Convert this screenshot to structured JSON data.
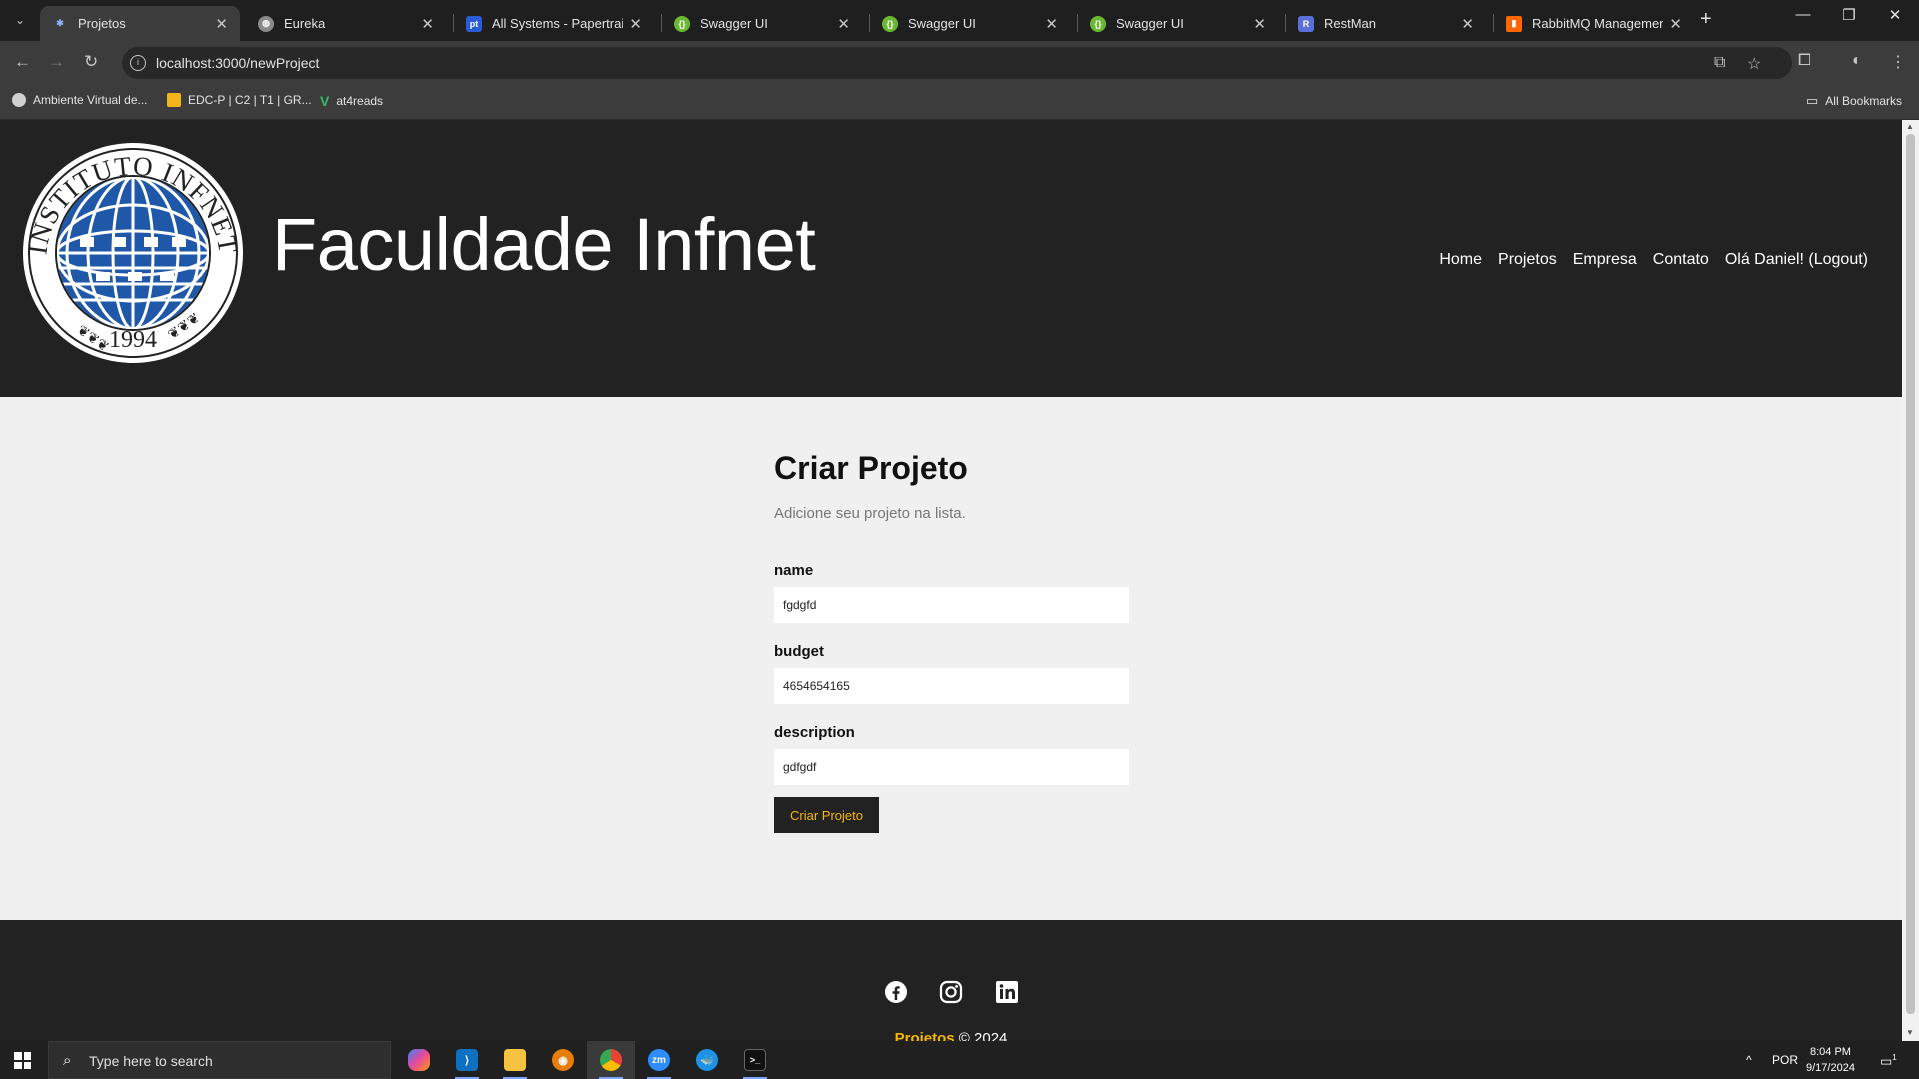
{
  "browser": {
    "tabs": [
      {
        "label": "Projetos",
        "active": true,
        "favicon_color": "#6b8fd6",
        "favicon_glyph": "✱"
      },
      {
        "label": "Eureka",
        "active": false,
        "favicon_color": "#8a8a8a",
        "favicon_glyph": "◍"
      },
      {
        "label": "All Systems - Papertrail",
        "active": false,
        "favicon_color": "#2a5bd7",
        "favicon_glyph": "pt"
      },
      {
        "label": "Swagger UI",
        "active": false,
        "favicon_color": "#6cb833",
        "favicon_glyph": "{}"
      },
      {
        "label": "Swagger UI",
        "active": false,
        "favicon_color": "#6cb833",
        "favicon_glyph": "{}"
      },
      {
        "label": "Swagger UI",
        "active": false,
        "favicon_color": "#6cb833",
        "favicon_glyph": "{}"
      },
      {
        "label": "RestMan",
        "active": false,
        "favicon_color": "#5a6fd8",
        "favicon_glyph": "R"
      },
      {
        "label": "RabbitMQ Management",
        "active": false,
        "favicon_color": "#ff6600",
        "favicon_glyph": "▮"
      }
    ],
    "url": "localhost:3000/newProject",
    "bookmarks": [
      {
        "label": "Ambiente Virtual de...",
        "icon_color": "#d0d0d0"
      },
      {
        "label": "EDC-P | C2 | T1 | GR...",
        "icon_color": "#f2b61c"
      },
      {
        "label": "at4reads",
        "icon_color": "#39b86b"
      }
    ],
    "all_bookmarks_label": "All Bookmarks"
  },
  "site": {
    "logo_text_top": "INSTITUTO INFNET",
    "logo_year": "1994",
    "title": "Faculdade Infnet",
    "nav": [
      "Home",
      "Projetos",
      "Empresa",
      "Contato",
      "Olá Daniel! (Logout)"
    ]
  },
  "form": {
    "title": "Criar Projeto",
    "subtitle": "Adicione seu projeto na lista.",
    "fields": [
      {
        "label": "name",
        "value": "fgdgfd"
      },
      {
        "label": "budget",
        "value": "4654654165"
      },
      {
        "label": "description",
        "value": "gdfgdf"
      }
    ],
    "submit_label": "Criar Projeto"
  },
  "footer": {
    "social_icons": [
      "facebook-icon",
      "instagram-icon",
      "linkedin-icon"
    ],
    "brand": "Projetos",
    "copyright": "© 2024"
  },
  "taskbar": {
    "search_placeholder": "Type here to search",
    "language": "POR",
    "time": "8:04 PM",
    "date": "9/17/2024",
    "notification_count": "1"
  },
  "colors": {
    "header_bg": "#222222",
    "page_bg": "#f0f0f0",
    "accent": "#f6b800",
    "logo_blue": "#1f58a8"
  }
}
